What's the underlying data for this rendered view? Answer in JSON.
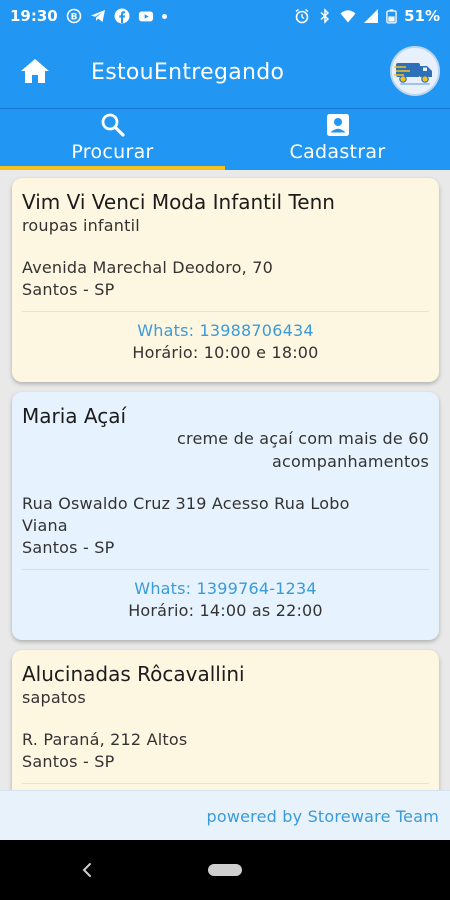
{
  "status": {
    "time": "19:30",
    "left_icons": [
      "b-circle-icon",
      "telegram-icon",
      "facebook-icon",
      "youtube-icon",
      "dot-icon"
    ],
    "right_icons": [
      "alarm-icon",
      "bluetooth-icon",
      "wifi-icon",
      "signal-icon",
      "battery-icon"
    ],
    "battery": "51%"
  },
  "appbar": {
    "title": "EstouEntregando",
    "home_icon": "home-icon",
    "logo": "store-delivery-logo"
  },
  "tabs": [
    {
      "label": "Procurar",
      "icon": "search-icon",
      "active": true
    },
    {
      "label": "Cadastrar",
      "icon": "contact-icon",
      "active": false
    }
  ],
  "stores": [
    {
      "name": "Vim Vi Venci Moda Infantil  Tenn",
      "description": "roupas infantil",
      "address_line1": "Avenida  Marechal Deodoro, 70",
      "address_line2": "",
      "city": "Santos - SP",
      "whats": "Whats: 13988706434",
      "hours": "Horário: 10:00 e 18:00"
    },
    {
      "name": "Maria Açaí",
      "description_line1": "creme de açaí com mais de 60",
      "description_line2": "acompanhamentos",
      "address_line1": "Rua Oswaldo Cruz 319  Acesso Rua Lobo",
      "address_line2": "Viana",
      "city": "Santos - SP",
      "whats": "Whats: 1399764-1234",
      "hours": "Horário: 14:00 as 22:00"
    },
    {
      "name": "Alucinadas Rôcavallini",
      "description": "sapatos",
      "address_line1": "R. Paraná, 212 Altos",
      "address_line2": "",
      "city": "Santos - SP"
    }
  ],
  "footer": {
    "powered": "powered by Storeware Team"
  },
  "colors": {
    "primary": "#2196f3",
    "tab_indicator": "#f4c21c",
    "card_yellow": "#fdf6e1",
    "card_blue": "#e6f2fd",
    "link": "#3a9bd9"
  }
}
